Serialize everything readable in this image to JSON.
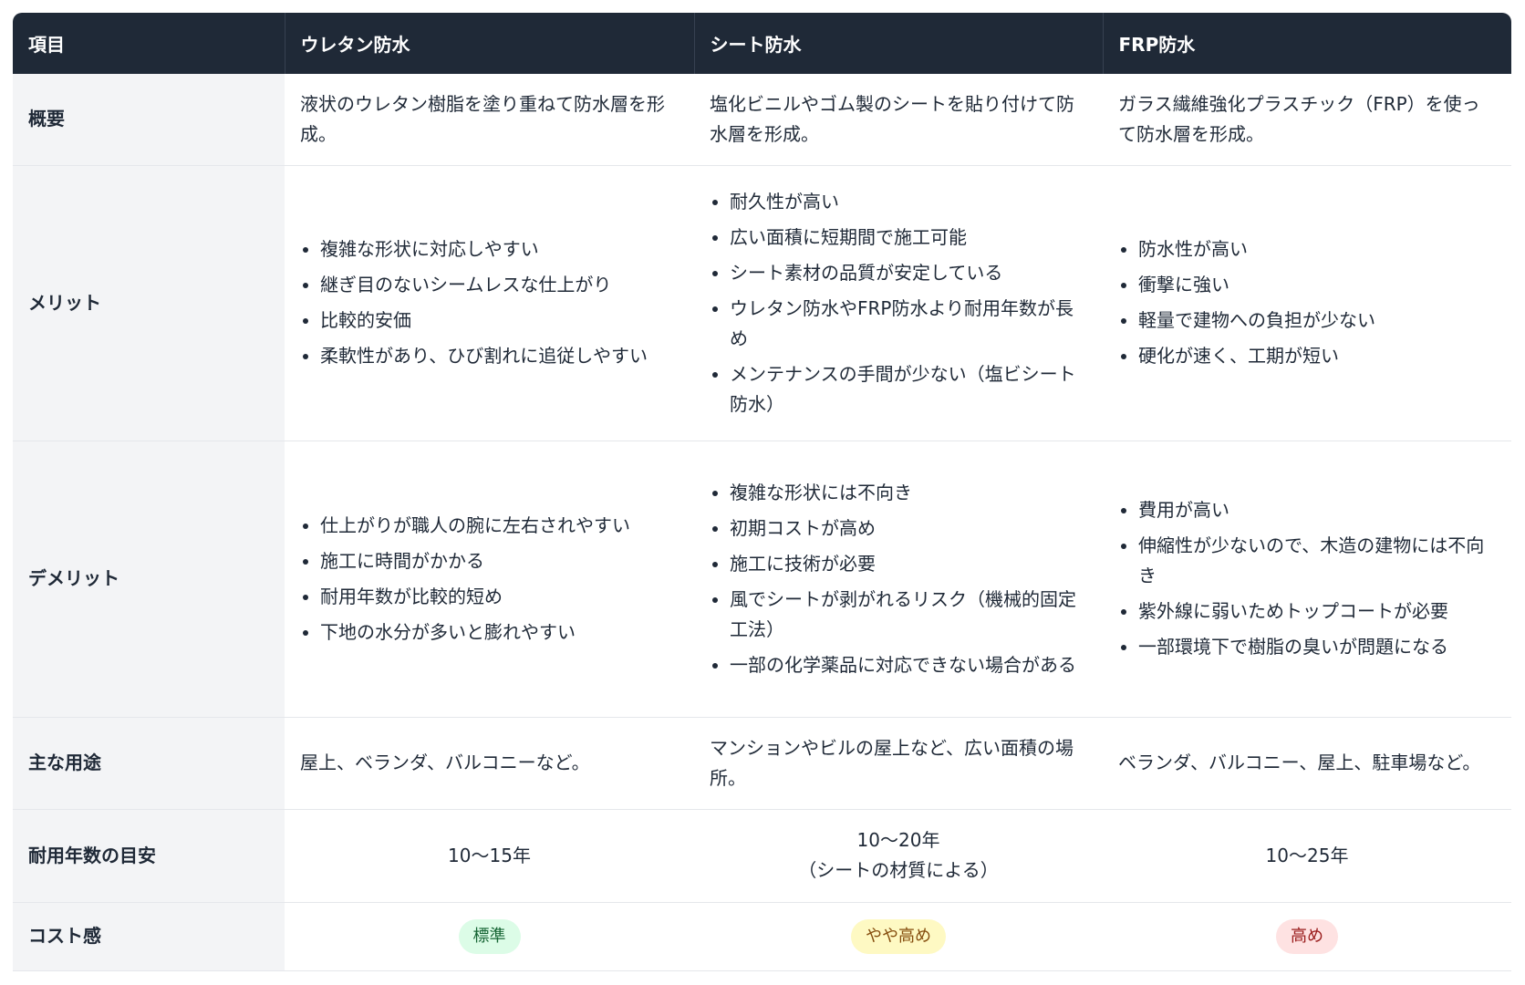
{
  "headers": [
    "項目",
    "ウレタン防水",
    "シート防水",
    "FRP防水"
  ],
  "rows": {
    "overview": {
      "label": "概要",
      "cells": [
        "液状のウレタン樹脂を塗り重ねて防水層を形成。",
        "塩化ビニルやゴム製のシートを貼り付けて防水層を形成。",
        "ガラス繊維強化プラスチック（FRP）を使って防水層を形成。"
      ]
    },
    "merits": {
      "label": "メリット",
      "cells": [
        [
          "複雑な形状に対応しやすい",
          "継ぎ目のないシームレスな仕上がり",
          "比較的安価",
          "柔軟性があり、ひび割れに追従しやすい"
        ],
        [
          "耐久性が高い",
          "広い面積に短期間で施工可能",
          "シート素材の品質が安定している",
          "ウレタン防水やFRP防水より耐用年数が長め",
          "メンテナンスの手間が少ない（塩ビシート防水）"
        ],
        [
          "防水性が高い",
          "衝撃に強い",
          "軽量で建物への負担が少ない",
          "硬化が速く、工期が短い"
        ]
      ]
    },
    "demerits": {
      "label": "デメリット",
      "cells": [
        [
          "仕上がりが職人の腕に左右されやすい",
          "施工に時間がかかる",
          "耐用年数が比較的短め",
          "下地の水分が多いと膨れやすい"
        ],
        [
          "複雑な形状には不向き",
          "初期コストが高め",
          "施工に技術が必要",
          "風でシートが剥がれるリスク（機械的固定工法）",
          "一部の化学薬品に対応できない場合がある"
        ],
        [
          "費用が高い",
          "伸縮性が少ないので、木造の建物には不向き",
          "紫外線に弱いためトップコートが必要",
          "一部環境下で樹脂の臭いが問題になる"
        ]
      ]
    },
    "uses": {
      "label": "主な用途",
      "cells": [
        "屋上、ベランダ、バルコニーなど。",
        "マンションやビルの屋上など、広い面積の場所。",
        "ベランダ、バルコニー、屋上、駐車場など。"
      ]
    },
    "lifespan": {
      "label": "耐用年数の目安",
      "cells": [
        "10〜15年",
        "10〜20年",
        "10〜25年"
      ],
      "note": "（シートの材質による）"
    },
    "cost": {
      "label": "コスト感",
      "cells": [
        "標準",
        "やや高め",
        "高め"
      ]
    }
  },
  "colors": {
    "header_bg": "#1f2937",
    "rowhead_bg": "#f3f4f6",
    "green": "#dcfce7",
    "yellow": "#fef9c3",
    "red": "#fee2e2"
  }
}
